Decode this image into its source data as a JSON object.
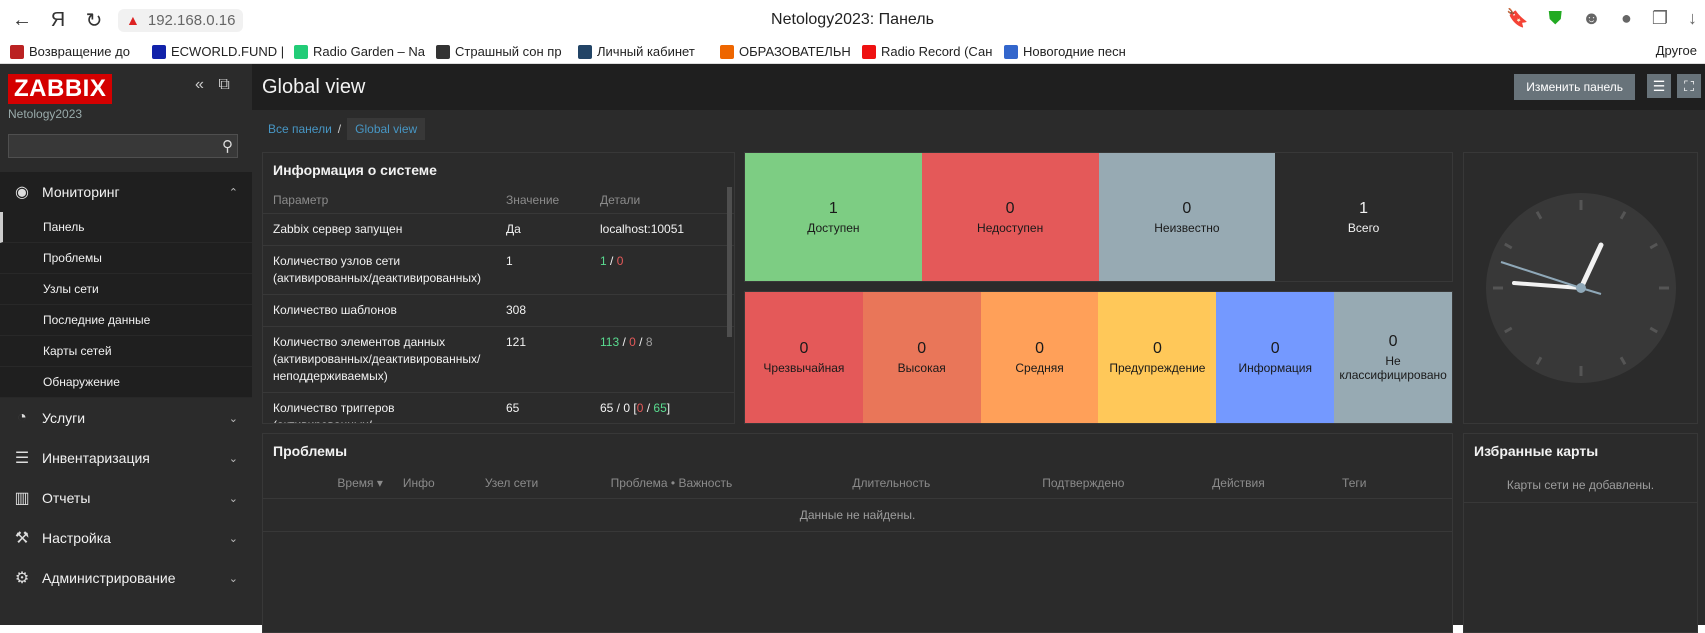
{
  "browser": {
    "address": "192.168.0.16",
    "window_title": "Netology2023: Панель",
    "bookmarks": [
      {
        "label": "Возвращение до",
        "color": "#b22"
      },
      {
        "label": "ECWORLD.FUND |",
        "color": "#12a"
      },
      {
        "label": "Radio Garden – Na",
        "color": "#2c7"
      },
      {
        "label": "Страшный сон пр",
        "color": "#333"
      },
      {
        "label": "Личный кабинет",
        "color": "#246"
      },
      {
        "label": "ОБРАЗОВАТЕЛЬН",
        "color": "#e60"
      },
      {
        "label": "Radio Record (Сан",
        "color": "#e11"
      },
      {
        "label": "Новогодние песн",
        "color": "#36c"
      }
    ],
    "bookmarks_other": "Другое"
  },
  "sidebar": {
    "logo": "ZABBIX",
    "server": "Netology2023",
    "menu": [
      {
        "label": "Мониторинг",
        "icon": "eye-icon",
        "glyph": "◉",
        "chev": "⌃"
      },
      {
        "label": "Услуги",
        "icon": "clock-icon",
        "glyph": "◔",
        "chev": "⌄"
      },
      {
        "label": "Инвентаризация",
        "icon": "list-icon",
        "glyph": "☰",
        "chev": "⌄"
      },
      {
        "label": "Отчеты",
        "icon": "bar-chart-icon",
        "glyph": "▥",
        "chev": "⌄"
      },
      {
        "label": "Настройка",
        "icon": "wrench-icon",
        "glyph": "⚒",
        "chev": "⌄"
      },
      {
        "label": "Администрирование",
        "icon": "gear-icon",
        "glyph": "⚙",
        "chev": "⌄"
      }
    ],
    "monitoring_items": [
      "Панель",
      "Проблемы",
      "Узлы сети",
      "Последние данные",
      "Карты сетей",
      "Обнаружение"
    ]
  },
  "header": {
    "title": "Global view",
    "edit_button": "Изменить панель",
    "breadcrumb": [
      "Все панели",
      "/",
      "Global view"
    ]
  },
  "system_info": {
    "title": "Информация о системе",
    "columns": [
      "Параметр",
      "Значение",
      "Детали"
    ],
    "rows": [
      {
        "param": "Zabbix сервер запущен",
        "value": "Да",
        "details": "localhost:10051"
      },
      {
        "param": "Количество узлов сети (активированных/деактивированных)",
        "value": "1",
        "d1": "1",
        "sep1": " / ",
        "d2": "0"
      },
      {
        "param": "Количество шаблонов",
        "value": "308",
        "details": ""
      },
      {
        "param": "Количество элементов данных (активированных/деактивированных/неподдерживаемых)",
        "value": "121",
        "d1": "113",
        "sep1": " / ",
        "d2": "0",
        "sep2": " / ",
        "d3": "8"
      },
      {
        "param": "Количество триггеров (активированных/",
        "value": "65",
        "details_prefix": "65 / 0 [",
        "d2": "0",
        "sep2": " / ",
        "d1": "65",
        "details_suffix": "]"
      }
    ]
  },
  "availability": [
    {
      "count": "1",
      "label": "Доступен",
      "color": "#7dcd83"
    },
    {
      "count": "0",
      "label": "Недоступен",
      "color": "#e45959"
    },
    {
      "count": "0",
      "label": "Неизвестно",
      "color": "#97aab3"
    },
    {
      "count": "1",
      "label": "Всего",
      "color": "#2b2b2b"
    }
  ],
  "severity": [
    {
      "count": "0",
      "label": "Чрезвычайная",
      "color": "#e45959"
    },
    {
      "count": "0",
      "label": "Высокая",
      "color": "#e97659"
    },
    {
      "count": "0",
      "label": "Средняя",
      "color": "#ffa059"
    },
    {
      "count": "0",
      "label": "Предупреждение",
      "color": "#ffc859"
    },
    {
      "count": "0",
      "label": "Информация",
      "color": "#7499ff"
    },
    {
      "count": "0",
      "label": "Не классифицировано",
      "color": "#97aab3"
    }
  ],
  "problems": {
    "title": "Проблемы",
    "columns": [
      "Время ▾",
      "Инфо",
      "Узел сети",
      "Проблема • Важность",
      "Длительность",
      "Подтверждено",
      "Действия",
      "Теги"
    ],
    "empty": "Данные не найдены."
  },
  "favorite_maps": {
    "title": "Избранные карты",
    "empty": "Карты сети не добавлены."
  }
}
